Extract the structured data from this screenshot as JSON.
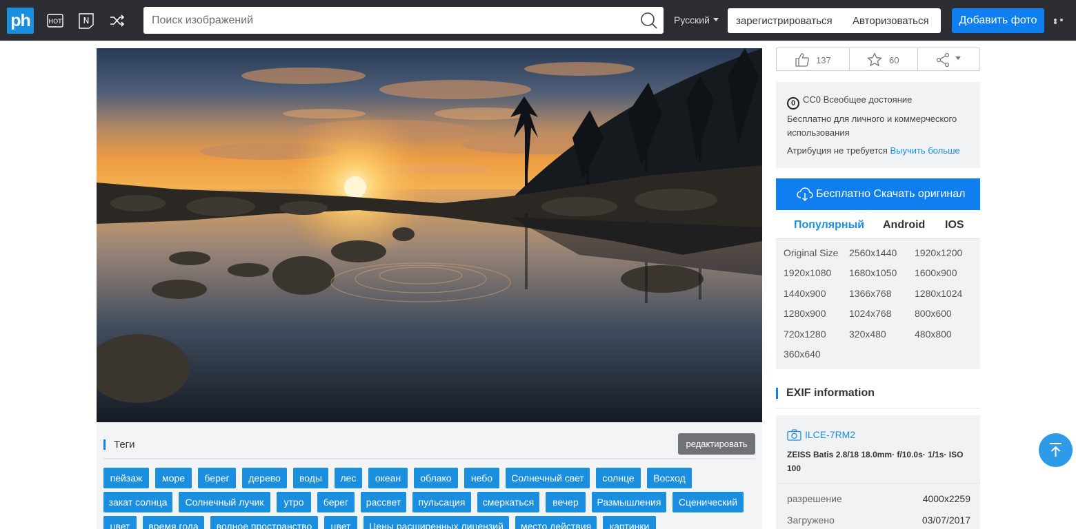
{
  "header": {
    "logo_text": "ph",
    "search_placeholder": "Поиск изображений",
    "language": "Русский",
    "register_label": "зарегистрироваться",
    "login_label": "Авторизоваться",
    "add_photo_label": "Добавить фото",
    "icons": [
      "hot-icon",
      "new-icon",
      "shuffle-icon",
      "search-icon",
      "more-icon"
    ]
  },
  "stats": {
    "likes": "137",
    "favorites": "60"
  },
  "license": {
    "title": "CC0 Всеобщее достояние",
    "line1": "Бесплатно для личного и коммерческого использования",
    "line2": "Атрибуция не требуется",
    "learn_more": "Выучить больше"
  },
  "download": {
    "button_label": "Бесплатно Скачать оригинал",
    "tabs": [
      "Популярный",
      "Android",
      "IOS"
    ],
    "sizes": [
      "Original Size",
      "2560x1440",
      "1920x1200",
      "1920x1080",
      "1680x1050",
      "1600x900",
      "1440x900",
      "1366x768",
      "1280x1024",
      "1280x900",
      "1024x768",
      "800x600",
      "720x1280",
      "320x480",
      "480x800",
      "360x640"
    ]
  },
  "exif": {
    "title": "EXIF information",
    "camera": "ILCE-7RM2",
    "lens": "ZEISS Batis 2.8/18 18.0mm· f/10.0s· 1/1s· ISO 100",
    "rows": [
      {
        "label": "разрешение",
        "value": "4000x2259"
      },
      {
        "label": "Загружено",
        "value": "03/07/2017"
      }
    ]
  },
  "tags_section": {
    "title": "Теги",
    "edit_label": "редактировать",
    "tags": [
      "пейзаж",
      "море",
      "берег",
      "дерево",
      "воды",
      "лес",
      "океан",
      "облако",
      "небо",
      "Солнечный свет",
      "солнце",
      "Восход",
      "закат солнца",
      "Солнечный лучик",
      "утро",
      "берег",
      "рассвет",
      "пульсация",
      "смеркаться",
      "вечер",
      "Размышления",
      "Сценический",
      "цвет",
      "время года",
      "водное пространство",
      "цвет",
      "Цены расширенных лицензий",
      "место действия",
      "картинки"
    ]
  },
  "colors": {
    "accent": "#0f7ff0",
    "tag": "#1a8fe0",
    "header": "#2b2d33"
  }
}
